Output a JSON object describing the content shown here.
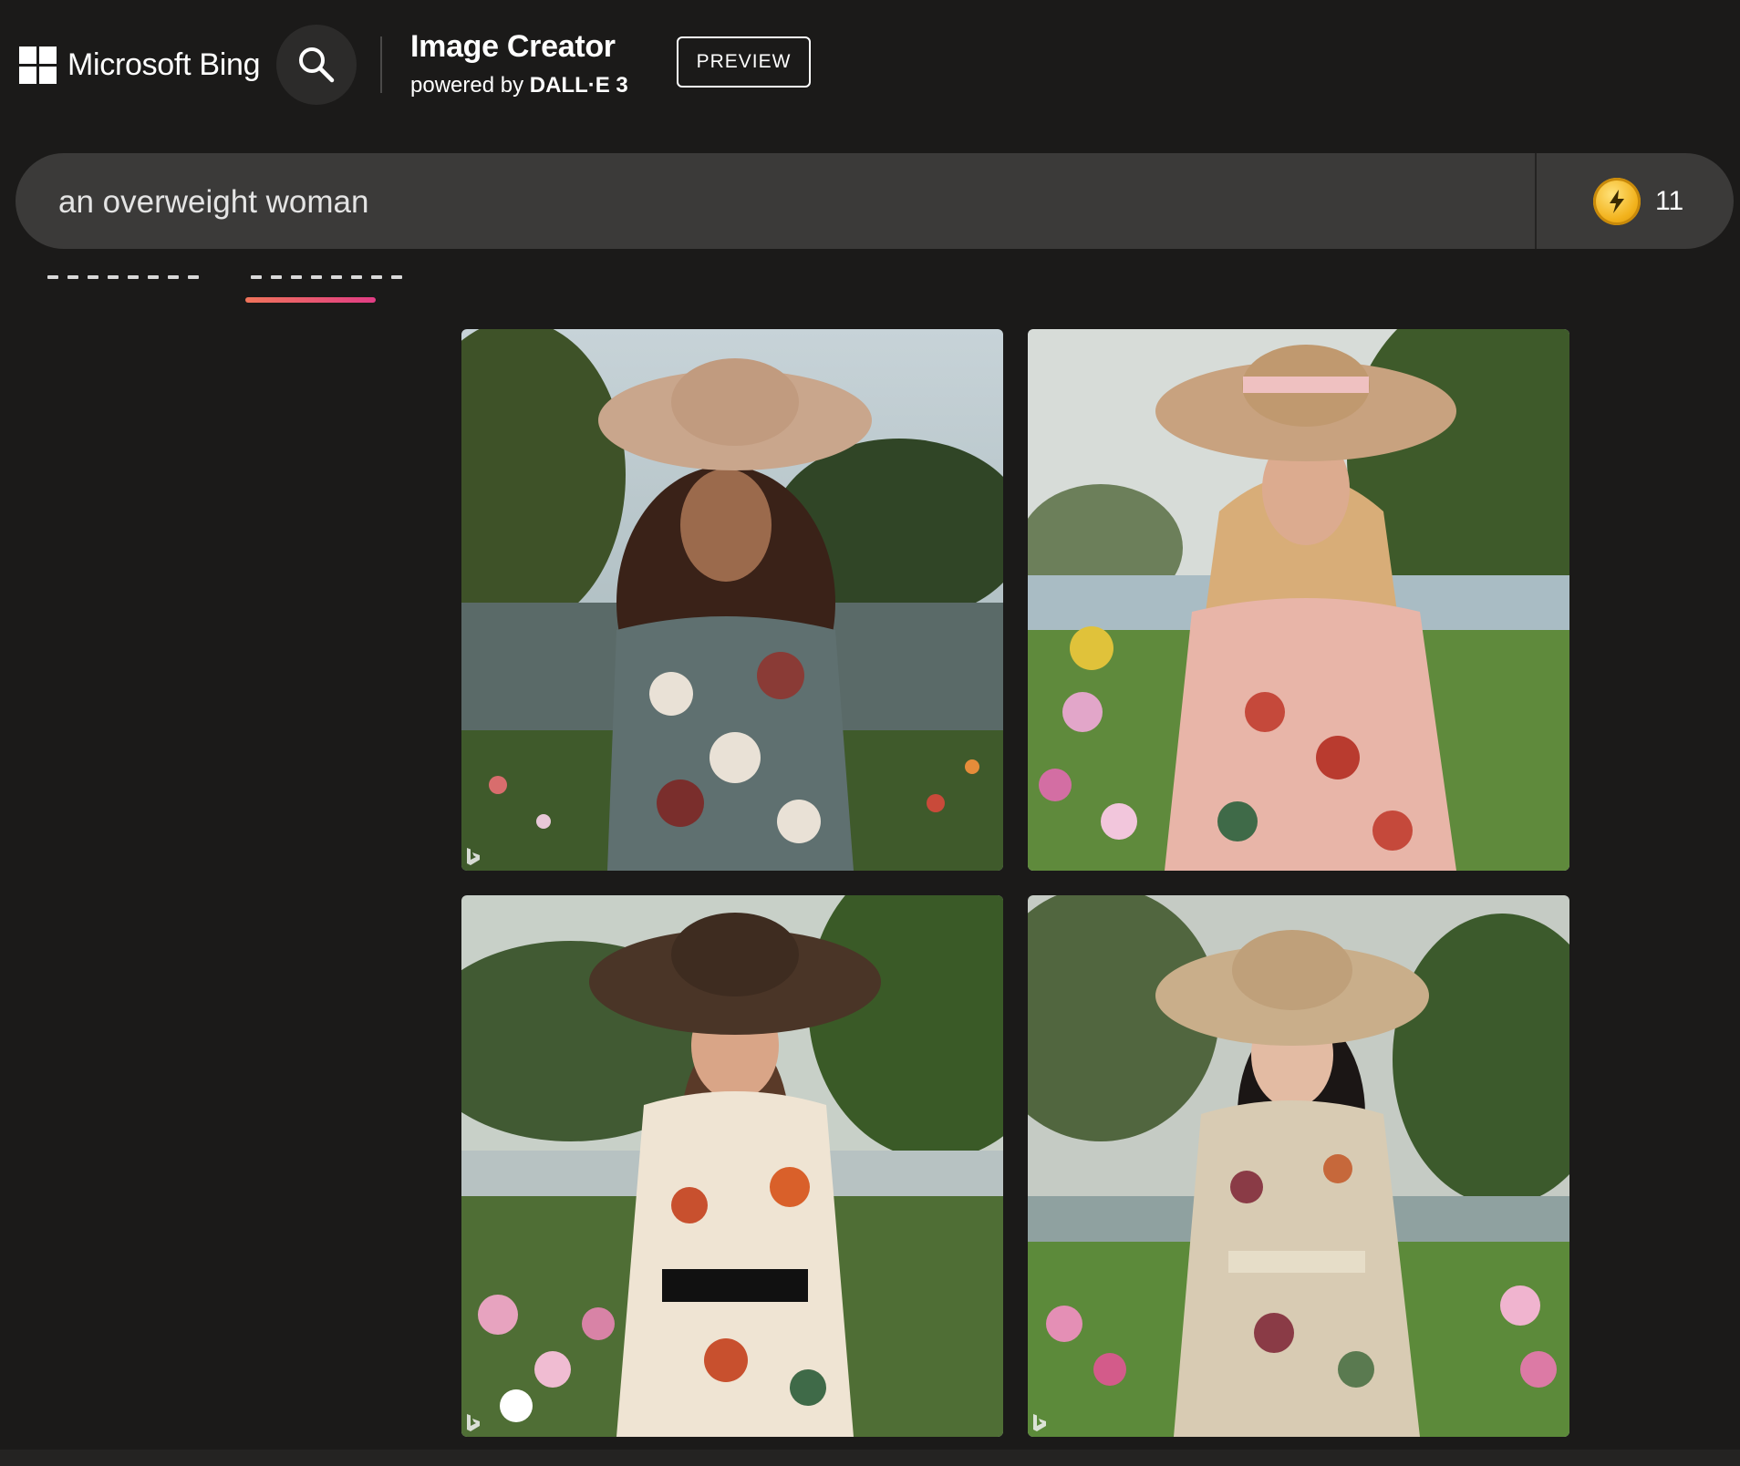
{
  "header": {
    "brand": "Microsoft Bing",
    "product_title": "Image Creator",
    "powered_by_prefix": "powered by",
    "powered_by_model": "DALL·E 3",
    "preview_badge": "PREVIEW"
  },
  "prompt": {
    "value": "an overweight woman",
    "boost_icon": "lightning-coin-icon",
    "boosts_remaining": "11"
  },
  "tabs": {
    "active_indicator_color": "#e8506f"
  },
  "results": {
    "images": [
      {
        "subject": "woman in wide-brim hat and floral wrap dress by a lake",
        "dress_color": "#5f7070",
        "hat_color": "#c9a68c"
      },
      {
        "subject": "woman in straw hat and pink floral dress in a park",
        "dress_color": "#e8b5a8",
        "hat_color": "#c8a27f"
      },
      {
        "subject": "woman in dark brown hat and cream floral dress in a garden",
        "dress_color": "#efe4d3",
        "hat_color": "#4a3527"
      },
      {
        "subject": "woman in straw hat and floral shirt dress in a park",
        "dress_color": "#d8cbb3",
        "hat_color": "#c9ae8a"
      }
    ],
    "watermark_icon": "bing-b-icon"
  },
  "colors": {
    "background": "#1b1a19",
    "prompt_bar": "#3b3a39",
    "coin": "#f2b21c",
    "tab_gradient_start": "#f0745a",
    "tab_gradient_end": "#e23d85"
  }
}
